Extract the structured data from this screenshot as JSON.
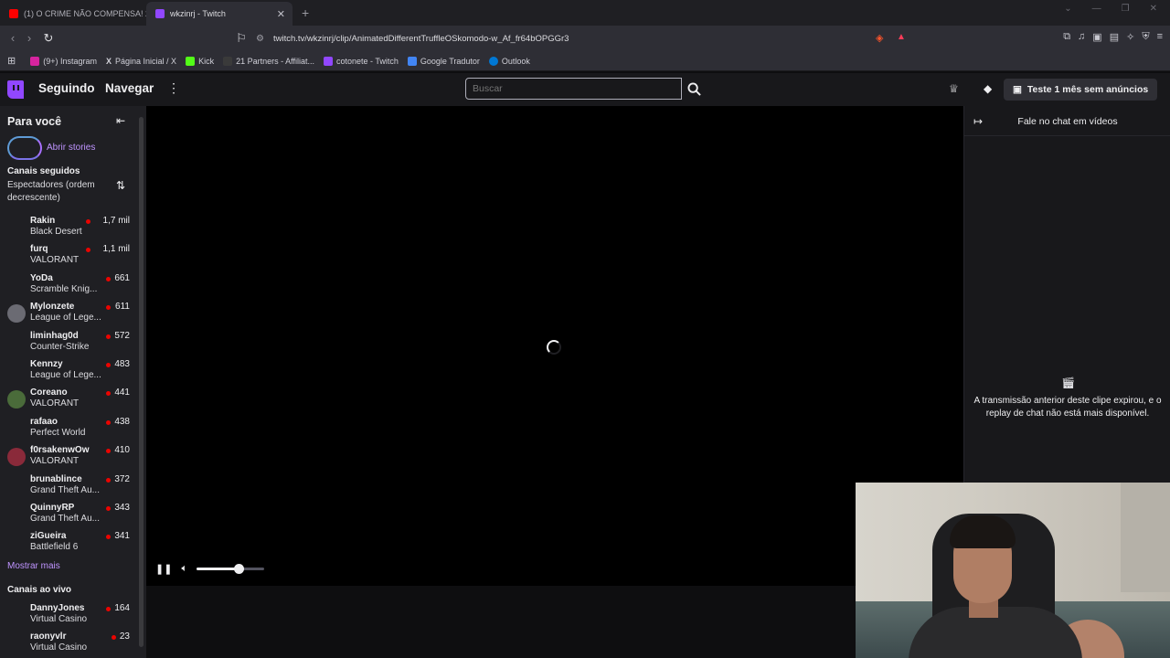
{
  "browser": {
    "tabs": [
      {
        "label": "(1) O CRIME NÃO COMPENSA! 26 to",
        "color": "#ff0000",
        "active": false
      },
      {
        "label": "wkzinrj - Twitch",
        "color": "#9147ff",
        "active": true
      }
    ],
    "new_tab": "+",
    "url": "twitch.tv/wkzinrj/clip/AnimatedDifferentTruffleOSkomodo-w_Af_fr64bOPGGr3",
    "bookmarks": [
      {
        "label": "(9+) Instagram",
        "color": "#d6249f"
      },
      {
        "label": "Página Inicial / X",
        "color": "#000000"
      },
      {
        "label": "Kick",
        "color": "#53fc18"
      },
      {
        "label": "21 Partners - Affiliat...",
        "color": "#1b1b1b"
      },
      {
        "label": "cotonete - Twitch",
        "color": "#9147ff"
      },
      {
        "label": "Google Tradutor",
        "color": "#4285f4"
      },
      {
        "label": "Outlook",
        "color": "#0078d4"
      }
    ]
  },
  "topnav": {
    "following": "Seguindo",
    "browse": "Navegar",
    "search_placeholder": "Buscar",
    "turbo": "Teste 1 mês sem anúncios"
  },
  "sidebar": {
    "title": "Para você",
    "stories": "Abrir stories",
    "followed_title": "Canais seguidos",
    "followed_sort": "Espectadores (ordem decrescente)",
    "channels": [
      {
        "name": "Rakin",
        "game": "Black Desert",
        "viewers": "1,7 mil"
      },
      {
        "name": "furq",
        "game": "VALORANT",
        "viewers": "1,1 mil"
      },
      {
        "name": "YoDa",
        "game": "Scramble Knig...",
        "viewers": "661"
      },
      {
        "name": "Mylonzete",
        "game": "League of Lege...",
        "viewers": "611"
      },
      {
        "name": "liminhag0d",
        "game": "Counter-Strike",
        "viewers": "572"
      },
      {
        "name": "Kennzy",
        "game": "League of Lege...",
        "viewers": "483"
      },
      {
        "name": "Coreano",
        "game": "VALORANT",
        "viewers": "441"
      },
      {
        "name": "rafaao",
        "game": "Perfect World",
        "viewers": "438"
      },
      {
        "name": "f0rsakenwOw",
        "game": "VALORANT",
        "viewers": "410"
      },
      {
        "name": "brunablince",
        "game": "Grand Theft Au...",
        "viewers": "372"
      },
      {
        "name": "QuinnyRP",
        "game": "Grand Theft Au...",
        "viewers": "343"
      },
      {
        "name": "ziGueira",
        "game": "Battlefield 6",
        "viewers": "341"
      }
    ],
    "show_more": "Mostrar mais",
    "live_title": "Canais ao vivo",
    "live_channels": [
      {
        "name": "DannyJones",
        "game": "Virtual Casino",
        "viewers": "164"
      },
      {
        "name": "raonyvlr",
        "game": "Virtual Casino",
        "viewers": "23"
      }
    ]
  },
  "player": {
    "volume": 0.62
  },
  "chat": {
    "title": "Fale no chat em vídeos",
    "message": "A transmissão anterior deste clipe expirou, e o replay de chat não está mais disponível."
  }
}
